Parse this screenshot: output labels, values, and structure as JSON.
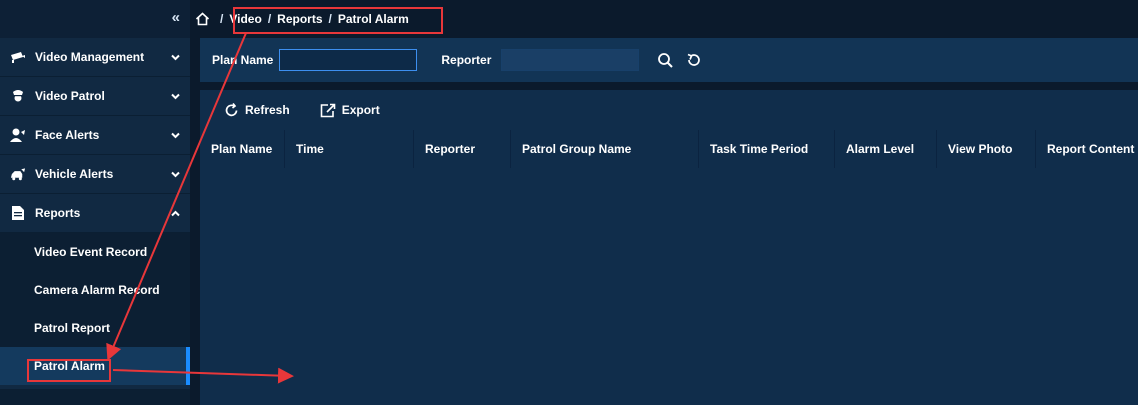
{
  "sidebar": {
    "collapse_glyph": "«",
    "items": [
      {
        "label": "Video Management",
        "icon": "video-camera-icon",
        "expanded": false
      },
      {
        "label": "Video Patrol",
        "icon": "police-officer-icon",
        "expanded": false
      },
      {
        "label": "Face Alerts",
        "icon": "person-alert-icon",
        "expanded": false
      },
      {
        "label": "Vehicle Alerts",
        "icon": "car-alert-icon",
        "expanded": false
      },
      {
        "label": "Reports",
        "icon": "document-icon",
        "expanded": true
      }
    ],
    "submenu": [
      {
        "label": "Video Event Record"
      },
      {
        "label": "Camera Alarm Record"
      },
      {
        "label": "Patrol Report"
      },
      {
        "label": "Patrol Alarm",
        "active": true
      }
    ]
  },
  "breadcrumb": {
    "separator": "/",
    "items": [
      "Video",
      "Reports",
      "Patrol Alarm"
    ]
  },
  "search": {
    "plan_name_label": "Plan Name",
    "plan_name_value": "",
    "reporter_label": "Reporter",
    "reporter_value": ""
  },
  "toolbar": {
    "refresh_label": "Refresh",
    "export_label": "Export"
  },
  "table": {
    "columns": [
      "Plan Name",
      "Time",
      "Reporter",
      "Patrol Group Name",
      "Task Time Period",
      "Alarm Level",
      "View Photo",
      "Report Content"
    ],
    "rows": []
  },
  "colors": {
    "accent": "#1a8cff",
    "annotation": "#e8373a",
    "panel": "#102d4b",
    "sidebar": "#112942"
  }
}
